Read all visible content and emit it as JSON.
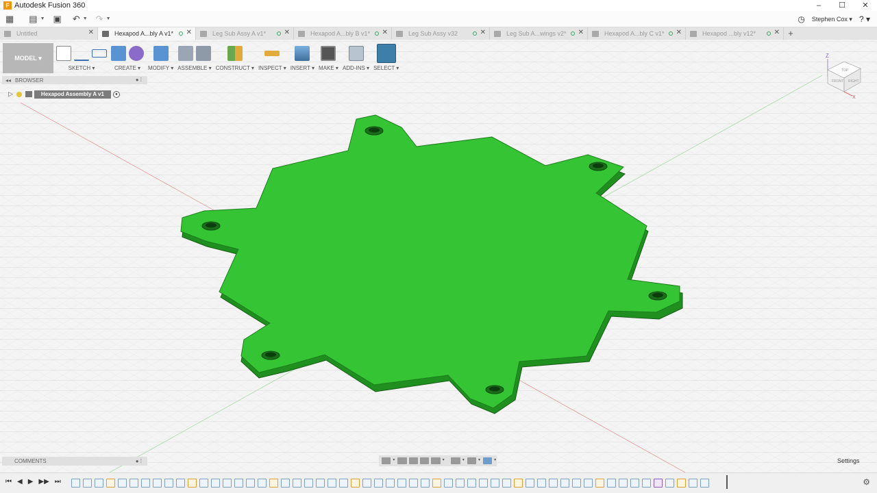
{
  "window": {
    "title": "Autodesk Fusion 360",
    "app_icon": "F",
    "controls": [
      "–",
      "☐",
      "✕"
    ]
  },
  "appbar": {
    "user": "Stephen Cox",
    "help_glyph": "?"
  },
  "tabs": [
    {
      "label": "Untitled",
      "active": false
    },
    {
      "label": "Hexapod A...bly A v1*",
      "active": true
    },
    {
      "label": "Leg Sub Assy A v1*",
      "active": false
    },
    {
      "label": "Hexapod A...bly B v1*",
      "active": false
    },
    {
      "label": "Leg Sub Assy v32",
      "active": false
    },
    {
      "label": "Leg Sub A...wings v2*",
      "active": false
    },
    {
      "label": "Hexapod A...bly C v1*",
      "active": false
    },
    {
      "label": "Hexapod ...bly v12*",
      "active": false
    }
  ],
  "toolbar": {
    "workspace": "MODEL",
    "groups": [
      {
        "label": "SKETCH",
        "icons": 3
      },
      {
        "label": "CREATE",
        "icons": 2
      },
      {
        "label": "MODIFY",
        "icons": 1
      },
      {
        "label": "ASSEMBLE",
        "icons": 2
      },
      {
        "label": "CONSTRUCT",
        "icons": 1
      },
      {
        "label": "INSPECT",
        "icons": 1
      },
      {
        "label": "INSERT",
        "icons": 1
      },
      {
        "label": "MAKE",
        "icons": 1
      },
      {
        "label": "ADD-INS",
        "icons": 1
      },
      {
        "label": "SELECT",
        "icons": 1
      }
    ],
    "colors": {
      "accent_select": "#3d7fa8",
      "create_purple": "#8a6bc9",
      "construct_green": "#6aa84f"
    }
  },
  "browser": {
    "title": "BROWSER",
    "root_item": "Hexapod Assembly A v1"
  },
  "comments": {
    "title": "COMMENTS"
  },
  "settings_label": "Settings",
  "model": {
    "part_color": "#35c434",
    "edge_color": "#1d7d1d"
  },
  "viewcube": {
    "faces": [
      "TOP",
      "FRONT",
      "RIGHT"
    ],
    "axes": [
      "Z",
      "X"
    ]
  }
}
